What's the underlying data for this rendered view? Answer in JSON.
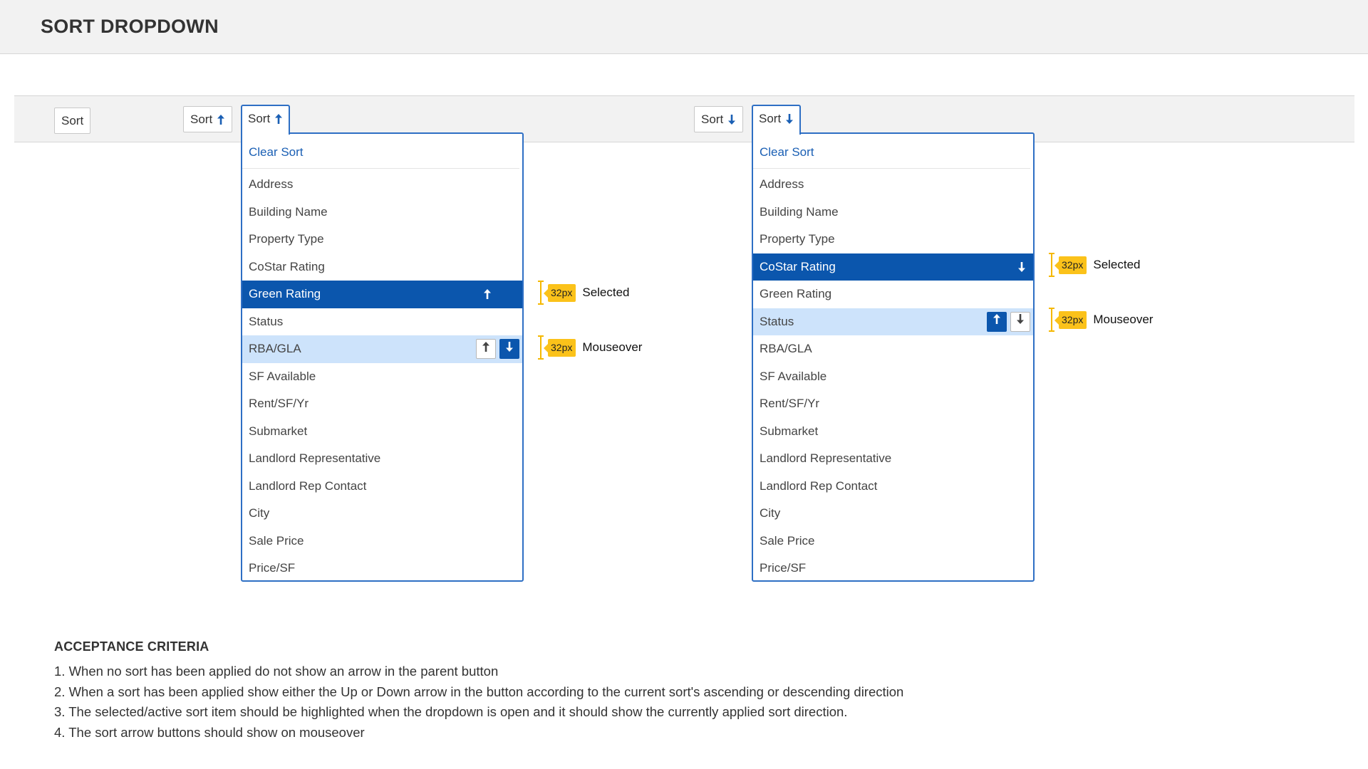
{
  "page": {
    "title": "SORT DROPDOWN"
  },
  "buttons": {
    "sort_none": "Sort",
    "sort_up": "Sort",
    "sort_up_open": "Sort",
    "sort_down": "Sort",
    "sort_down_open": "Sort"
  },
  "dropdown_left": {
    "clear": "Clear Sort",
    "items": [
      "Address",
      "Building Name",
      "Property Type",
      "CoStar Rating",
      "Green Rating",
      "Status",
      "RBA/GLA",
      "SF Available",
      "Rent/SF/Yr",
      "Submarket",
      "Landlord Representative",
      "Landlord Rep Contact",
      "City",
      "Sale Price",
      "Price/SF"
    ],
    "selected": "Green Rating",
    "selected_direction": "up",
    "hovered": "RBA/GLA",
    "hover_active_direction": "down"
  },
  "dropdown_right": {
    "clear": "Clear Sort",
    "items": [
      "Address",
      "Building Name",
      "Property Type",
      "CoStar Rating",
      "Green Rating",
      "Status",
      "RBA/GLA",
      "SF Available",
      "Rent/SF/Yr",
      "Submarket",
      "Landlord Representative",
      "Landlord Rep Contact",
      "City",
      "Sale Price",
      "Price/SF"
    ],
    "selected": "CoStar Rating",
    "selected_direction": "down",
    "hovered": "Status",
    "hover_active_direction": "up"
  },
  "annotations": {
    "left_selected": {
      "size": "32px",
      "label": "Selected"
    },
    "left_mouseover": {
      "size": "32px",
      "label": "Mouseover"
    },
    "right_selected": {
      "size": "32px",
      "label": "Selected"
    },
    "right_mouseover": {
      "size": "32px",
      "label": "Mouseover"
    }
  },
  "acceptance": {
    "title": "ACCEPTANCE CRITERIA",
    "items": [
      "1. When no sort has been applied do not show an arrow in the parent button",
      "2. When a sort has been applied show either the Up or Down arrow in the button according to the current sort's ascending or descending direction",
      "3. The selected/active sort item should be highlighted when the dropdown is open and it should show the currently applied sort direction.",
      "4. The sort arrow buttons should show on mouseover"
    ]
  },
  "colors": {
    "accent": "#0b56ad",
    "hover": "#cde3fb",
    "annotation": "#fbc21a",
    "border_open": "#2e6fc4"
  },
  "icons": {
    "up": "arrow-up-icon",
    "down": "arrow-down-icon"
  }
}
